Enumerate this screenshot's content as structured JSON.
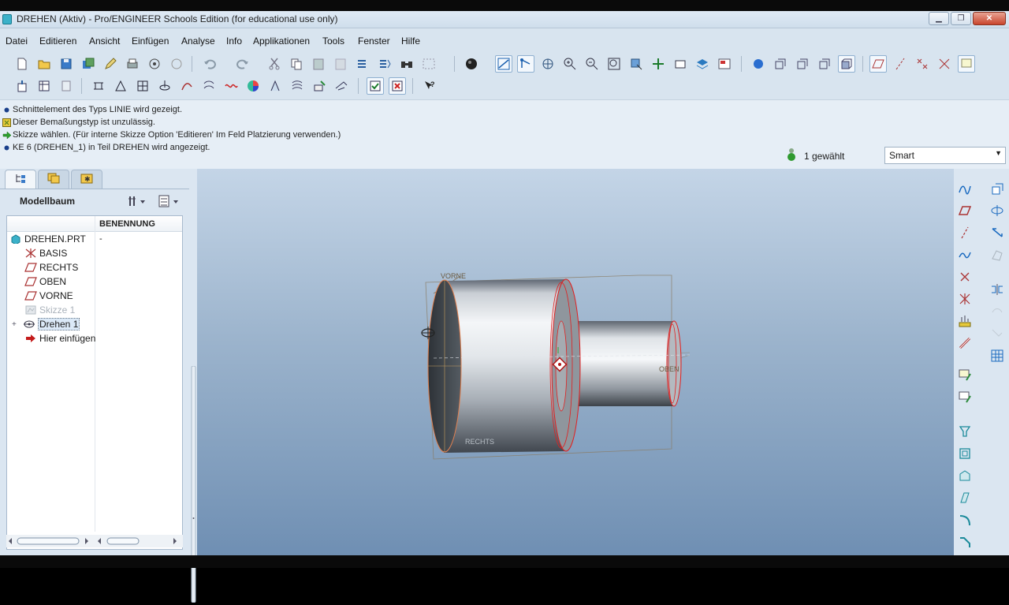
{
  "window": {
    "title": "DREHEN (Aktiv) - Pro/ENGINEER Schools Edition (for educational use only)"
  },
  "menu": [
    "Datei",
    "Editieren",
    "Ansicht",
    "Einfügen",
    "Analyse",
    "Info",
    "Applikationen",
    "Tools",
    "Fenster",
    "Hilfe"
  ],
  "messages": [
    {
      "text": "Schnittelement des Typs LINIE wird gezeigt.",
      "icon": "info-bullet-icon"
    },
    {
      "text": "Dieser Bemaßungstyp ist unzulässig.",
      "icon": "warning-icon"
    },
    {
      "text": "Skizze wählen. (Für interne Skizze Option 'Editieren' Im Feld Platzierung verwenden.)",
      "icon": "prompt-arrow-icon"
    },
    {
      "text": "KE 6 (DREHEN_1) in Teil DREHEN wird angezeigt.",
      "icon": "info-bullet-icon"
    }
  ],
  "selection": {
    "count_label": "1 gewählt",
    "filter_value": "Smart"
  },
  "panel": {
    "title": "Modellbaum",
    "column_header": "BENENNUNG",
    "items": [
      {
        "label": "DREHEN.PRT",
        "value": "-",
        "icon": "part-icon",
        "indent": 0,
        "state": "normal"
      },
      {
        "label": "BASIS",
        "value": "",
        "icon": "csys-icon",
        "indent": 1,
        "state": "normal"
      },
      {
        "label": "RECHTS",
        "value": "",
        "icon": "datum-plane-icon",
        "indent": 1,
        "state": "normal"
      },
      {
        "label": "OBEN",
        "value": "",
        "icon": "datum-plane-icon",
        "indent": 1,
        "state": "normal"
      },
      {
        "label": "VORNE",
        "value": "",
        "icon": "datum-plane-icon",
        "indent": 1,
        "state": "normal"
      },
      {
        "label": "Skizze 1",
        "value": "",
        "icon": "sketch-icon",
        "indent": 1,
        "state": "hidden"
      },
      {
        "label": "Drehen 1",
        "value": "",
        "icon": "revolve-icon",
        "indent": 1,
        "state": "selected"
      },
      {
        "label": "Hier einfügen",
        "value": "",
        "icon": "insert-here-arrow-icon",
        "indent": 1,
        "state": "normal"
      }
    ]
  },
  "viewport": {
    "datum_labels": {
      "front": "VORNE",
      "top": "OBEN",
      "right": "RECHTS"
    }
  },
  "colors": {
    "highlight": "#e02020",
    "background_top": "#c4d5e7",
    "background_bottom": "#6f8fb3"
  }
}
